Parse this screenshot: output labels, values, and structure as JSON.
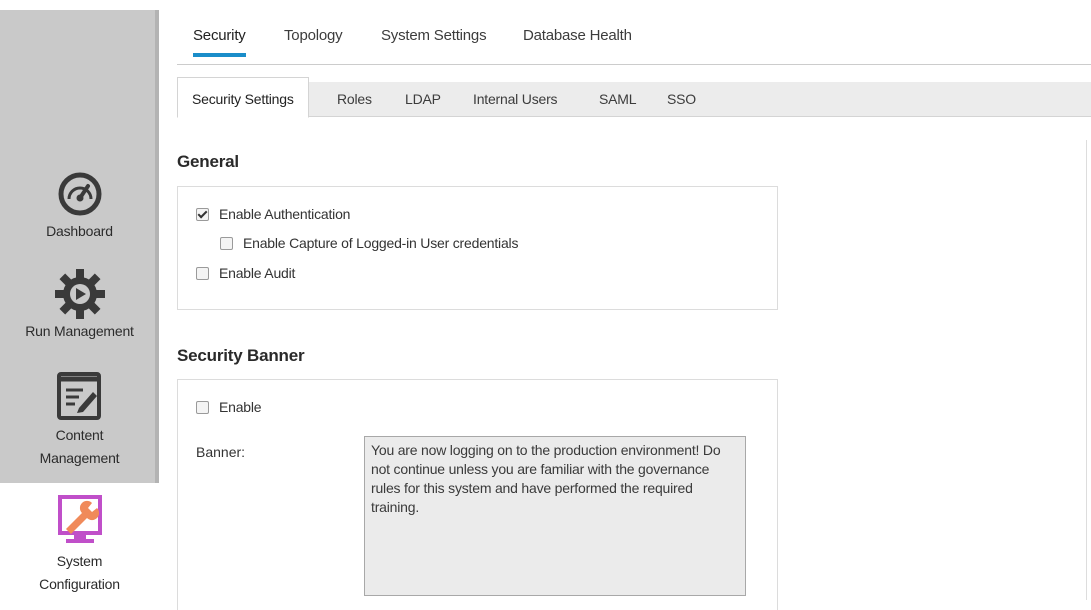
{
  "sidebar": {
    "items": [
      {
        "label": "Dashboard",
        "icon": "speedometer-icon"
      },
      {
        "label": "Run Management",
        "icon": "gear-play-icon"
      },
      {
        "label": "Content Management",
        "label_line1": "Content",
        "label_line2": "Management",
        "icon": "document-edit-icon"
      },
      {
        "label": "System Configuration",
        "label_line1": "System",
        "label_line2": "Configuration",
        "icon": "wrench-monitor-icon"
      }
    ]
  },
  "top_tabs": [
    {
      "label": "Security",
      "active": true
    },
    {
      "label": "Topology",
      "active": false
    },
    {
      "label": "System Settings",
      "active": false
    },
    {
      "label": "Database Health",
      "active": false
    }
  ],
  "sub_tabs": [
    {
      "label": "Security Settings",
      "active": true
    },
    {
      "label": "Roles",
      "active": false
    },
    {
      "label": "LDAP",
      "active": false
    },
    {
      "label": "Internal Users",
      "active": false
    },
    {
      "label": "SAML",
      "active": false
    },
    {
      "label": "SSO",
      "active": false
    }
  ],
  "general": {
    "title": "General",
    "enable_authentication": {
      "label": "Enable Authentication",
      "checked": true
    },
    "capture_credentials": {
      "label": "Enable Capture of Logged-in User credentials",
      "checked": false
    },
    "enable_audit": {
      "label": "Enable Audit",
      "checked": false
    }
  },
  "security_banner": {
    "title": "Security Banner",
    "enable": {
      "label": "Enable",
      "checked": false
    },
    "banner_label": "Banner:",
    "banner_text": "You are now logging on to the production environment! Do not continue unless you are familiar with the governance rules for this system and have performed the required training."
  },
  "colors": {
    "accent": "#1a8dc9",
    "sidebar_bg": "#c9c9c9",
    "system_config_icon": "#c04fc9",
    "wrench": "#f08a5a"
  }
}
